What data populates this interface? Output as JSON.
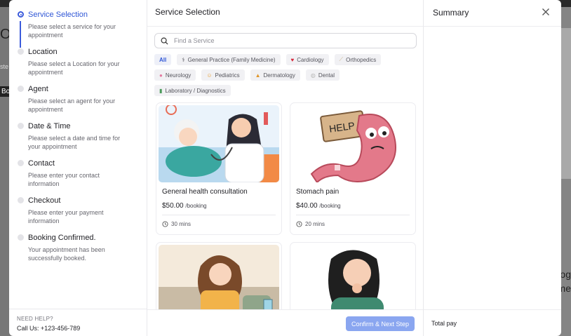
{
  "background": {
    "left_fragments": [
      "O",
      "ste",
      "Bo"
    ],
    "right_fragments": [
      "log",
      "me"
    ]
  },
  "steps": [
    {
      "title": "Service Selection",
      "desc": "Please select a service for your appointment",
      "active": true
    },
    {
      "title": "Location",
      "desc": "Please select a Location for your appointment",
      "active": false
    },
    {
      "title": "Agent",
      "desc": "Please select an agent for your appointment",
      "active": false
    },
    {
      "title": "Date & Time",
      "desc": "Please select a date and time for your appointment",
      "active": false
    },
    {
      "title": "Contact",
      "desc": "Please enter your contact information",
      "active": false
    },
    {
      "title": "Checkout",
      "desc": "Please enter your payment information",
      "active": false
    },
    {
      "title": "Booking Confirmed.",
      "desc": "Your appointment has been successfully booked.",
      "active": false
    }
  ],
  "help": {
    "label": "NEED HELP?",
    "phone": "Call Us: +123-456-789"
  },
  "main": {
    "title": "Service Selection",
    "search_placeholder": "Find a Service",
    "categories": [
      {
        "label": "All",
        "icon": ""
      },
      {
        "label": "General Practice (Family Medicine)",
        "icon": "stethoscope-icon"
      },
      {
        "label": "Cardiology",
        "icon": "heart-icon"
      },
      {
        "label": "Orthopedics",
        "icon": "bone-icon"
      },
      {
        "label": "Neurology",
        "icon": "brain-icon"
      },
      {
        "label": "Pediatrics",
        "icon": "baby-icon"
      },
      {
        "label": "Dermatology",
        "icon": "lotion-icon"
      },
      {
        "label": "Dental",
        "icon": "tooth-icon"
      },
      {
        "label": "Laboratory / Diagnostics",
        "icon": "test-tube-icon"
      }
    ],
    "services": [
      {
        "name": "General health consultation",
        "price": "$50.00",
        "unit": "/booking",
        "duration": "30 mins"
      },
      {
        "name": "Stomach pain",
        "price": "$40.00",
        "unit": "/booking",
        "duration": "20 mins"
      },
      {
        "name": "",
        "price": "",
        "unit": "",
        "duration": ""
      },
      {
        "name": "",
        "price": "",
        "unit": "",
        "duration": ""
      }
    ],
    "stomach_sign": "HELP",
    "next_button": "Confirm & Next Step"
  },
  "summary": {
    "title": "Summary",
    "total_label": "Total pay"
  },
  "colors": {
    "accent": "#2f56d6",
    "button": "#8aa6f0"
  }
}
